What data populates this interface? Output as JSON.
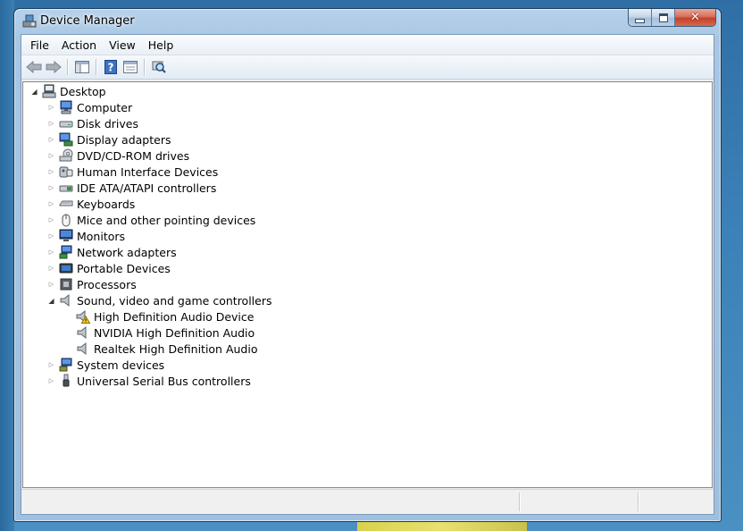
{
  "window": {
    "title": "Device Manager",
    "close_glyph": "✕"
  },
  "menu": [
    "File",
    "Action",
    "View",
    "Help"
  ],
  "toolbar_icons": [
    "back-arrow-icon",
    "forward-arrow-icon",
    "show-hide-console-tree-icon",
    "help-icon",
    "properties-icon",
    "scan-hardware-icon"
  ],
  "tree": {
    "root": "Desktop",
    "categories": [
      {
        "label": "Computer",
        "icon": "computer-icon"
      },
      {
        "label": "Disk drives",
        "icon": "disk-drive-icon"
      },
      {
        "label": "Display adapters",
        "icon": "display-adapter-icon"
      },
      {
        "label": "DVD/CD-ROM drives",
        "icon": "dvd-drive-icon"
      },
      {
        "label": "Human Interface Devices",
        "icon": "hid-icon"
      },
      {
        "label": "IDE ATA/ATAPI controllers",
        "icon": "ide-controller-icon"
      },
      {
        "label": "Keyboards",
        "icon": "keyboard-icon"
      },
      {
        "label": "Mice and other pointing devices",
        "icon": "mouse-icon"
      },
      {
        "label": "Monitors",
        "icon": "monitor-icon"
      },
      {
        "label": "Network adapters",
        "icon": "network-adapter-icon"
      },
      {
        "label": "Portable Devices",
        "icon": "portable-device-icon"
      },
      {
        "label": "Processors",
        "icon": "processor-icon"
      },
      {
        "label": "Sound, video and game controllers",
        "icon": "speaker-icon",
        "expanded": true,
        "children": [
          {
            "label": "High Definition Audio Device",
            "icon": "speaker-warning-icon"
          },
          {
            "label": "NVIDIA High Definition Audio",
            "icon": "speaker-icon"
          },
          {
            "label": "Realtek High Definition Audio",
            "icon": "speaker-icon"
          }
        ]
      },
      {
        "label": "System devices",
        "icon": "system-devices-icon"
      },
      {
        "label": "Universal Serial Bus controllers",
        "icon": "usb-icon"
      }
    ]
  },
  "status": [
    "",
    "",
    ""
  ],
  "colors": {
    "titlebar": "#a9c7e4",
    "close_button": "#c2422a",
    "tree_bg": "#ffffff"
  }
}
